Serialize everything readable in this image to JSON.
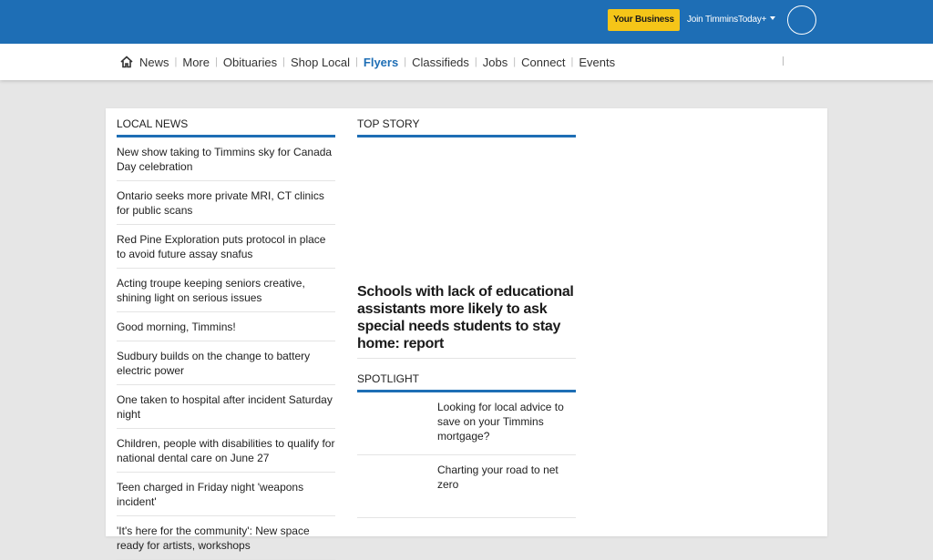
{
  "header": {
    "your_business": "Your Business",
    "join_label": "Join TimminsToday+"
  },
  "nav": {
    "items": [
      {
        "label": "News",
        "active": false
      },
      {
        "label": "More",
        "active": false
      },
      {
        "label": "Obituaries",
        "active": false
      },
      {
        "label": "Shop Local",
        "active": false
      },
      {
        "label": "Flyers",
        "active": true
      },
      {
        "label": "Classifieds",
        "active": false
      },
      {
        "label": "Jobs",
        "active": false
      },
      {
        "label": "Connect",
        "active": false
      },
      {
        "label": "Events",
        "active": false
      }
    ]
  },
  "local_news": {
    "heading": "LOCAL NEWS",
    "items": [
      "New show taking to Timmins sky for Canada Day celebration",
      "Ontario seeks more private MRI, CT clinics for public scans",
      "Red Pine Exploration puts protocol in place to avoid future assay snafus",
      "Acting troupe keeping seniors creative, shining light on serious issues",
      "Good morning, Timmins!",
      "Sudbury builds on the change to battery electric power",
      "One taken to hospital after incident Saturday night",
      "Children, people with disabilities to qualify for national dental care on June 27",
      "Teen charged in Friday night 'weapons incident'",
      "'It's here for the community': New space ready for artists, workshops"
    ]
  },
  "top_story": {
    "heading": "TOP STORY",
    "title": "Schools with lack of educational assistants more likely to ask special needs students to stay home: report"
  },
  "spotlight": {
    "heading": "SPOTLIGHT",
    "items": [
      "Looking for local advice to save on your Timmins mortgage?",
      "Charting your road to net zero"
    ]
  }
}
